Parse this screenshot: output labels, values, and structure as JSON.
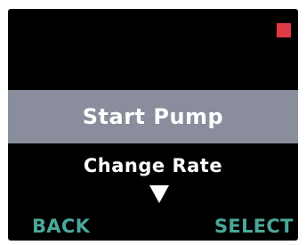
{
  "colors": {
    "screen_background": "#000000",
    "highlight_background": "#8a8d9c",
    "menu_text": "#ffffff",
    "softkey_text": "#4aa89a",
    "status_indicator": "#e03a45"
  },
  "status": {
    "indicator_icon": "red-square-icon"
  },
  "menu": {
    "selected_item": "Start Pump",
    "next_item": "Change Rate",
    "scroll_icon": "down-triangle-icon"
  },
  "softkeys": {
    "left_label": "BACK",
    "right_label": "SELECT"
  }
}
